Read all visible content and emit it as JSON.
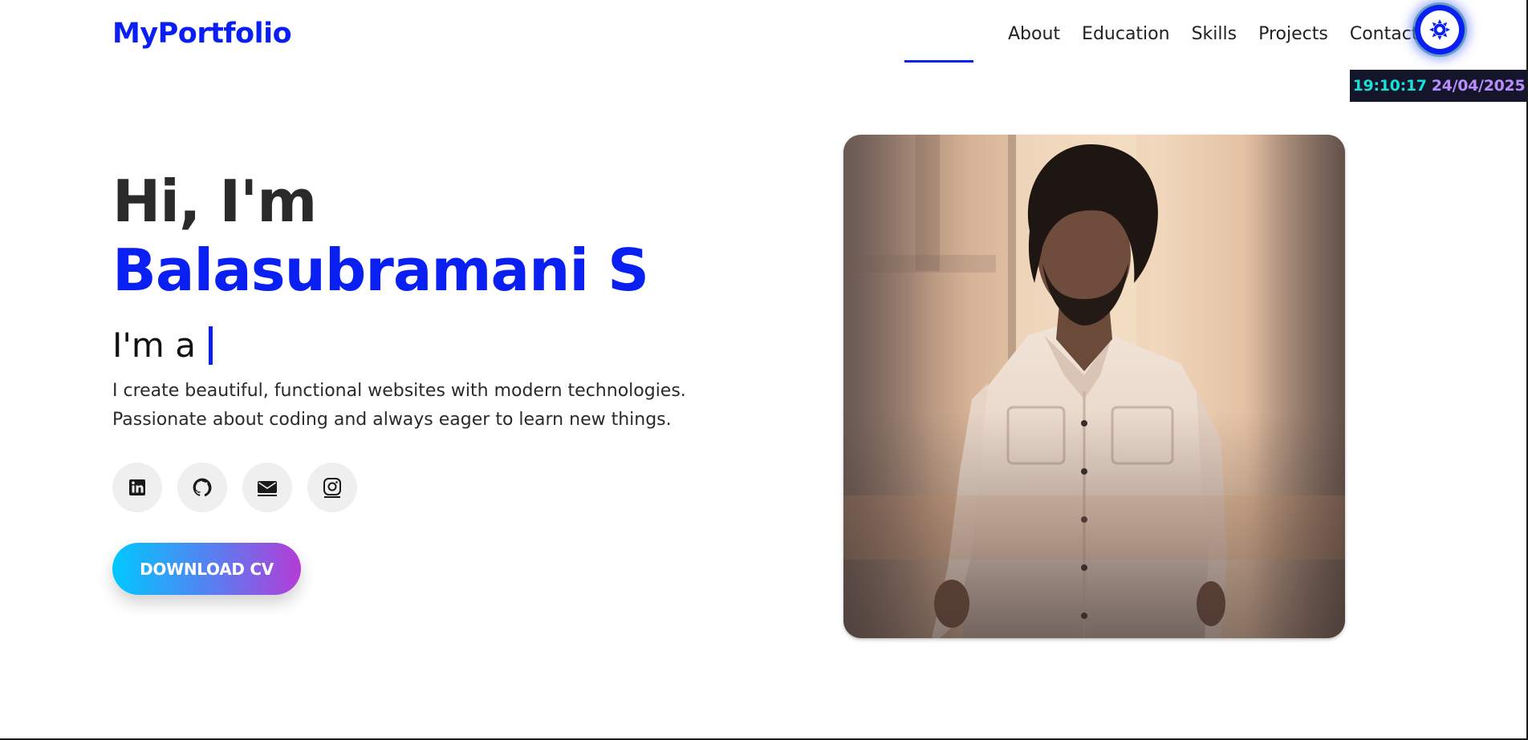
{
  "header": {
    "logo": "MyPortfolio",
    "nav": [
      {
        "label": "About"
      },
      {
        "label": "Education"
      },
      {
        "label": "Skills"
      },
      {
        "label": "Projects"
      },
      {
        "label": "Contact"
      }
    ],
    "theme_toggle_icon": "sun-icon"
  },
  "clock": {
    "time": "19:10:17",
    "date": "24/04/2025"
  },
  "hero": {
    "greeting_prefix": "Hi, I'm ",
    "name": "Balasubramani S",
    "role_prefix": "I'm a",
    "intro": "I create beautiful, functional websites with modern technologies. Passionate about coding and always eager to learn new things.",
    "socials": [
      {
        "icon": "linkedin-icon"
      },
      {
        "icon": "github-icon"
      },
      {
        "icon": "email-icon"
      },
      {
        "icon": "instagram-icon"
      }
    ],
    "cv_button": "DOWNLOAD CV"
  },
  "colors": {
    "accent": "#0a1ff2",
    "clock_bg": "#14142a",
    "clock_time": "#17e0d9",
    "clock_date": "#b88cff"
  }
}
